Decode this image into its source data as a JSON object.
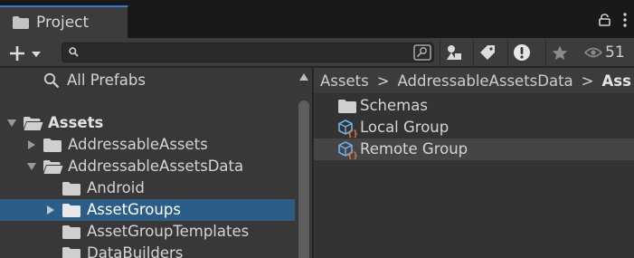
{
  "tab": {
    "title": "Project",
    "icon": "folder-icon"
  },
  "tabbar_icons": [
    "lock-icon",
    "more-menu-icon"
  ],
  "toolbar": {
    "add_label": "+",
    "search": {
      "value": "",
      "placeholder": ""
    },
    "buttons": [
      "type-filter-icon",
      "label-filter-icon",
      "warning-filter-icon",
      "favorite-icon"
    ],
    "hidden_count": "51"
  },
  "tree": [
    {
      "label": "All Prefabs",
      "icon": "search-icon"
    },
    {
      "label": "Assets",
      "icon": "folder-open-icon",
      "expanded": true
    },
    {
      "label": "AddressableAssets",
      "icon": "folder-icon",
      "expanded": false
    },
    {
      "label": "AddressableAssetsData",
      "icon": "folder-open-icon",
      "expanded": true
    },
    {
      "label": "Android",
      "icon": "folder-icon"
    },
    {
      "label": "AssetGroups",
      "icon": "folder-icon",
      "selected": true
    },
    {
      "label": "AssetGroupTemplates",
      "icon": "folder-icon"
    },
    {
      "label": "DataBuilders",
      "icon": "folder-icon"
    }
  ],
  "breadcrumb": {
    "items": [
      "Assets",
      "AddressableAssetsData",
      "Ass"
    ],
    "separator": ">"
  },
  "files": [
    {
      "label": "Schemas",
      "icon": "folder-icon"
    },
    {
      "label": "Local Group",
      "icon": "addressable-group-icon"
    },
    {
      "label": "Remote Group",
      "icon": "addressable-group-icon",
      "highlighted": true
    }
  ],
  "colors": {
    "selection": "#2c5d87",
    "tab_accent": "#3a78d0",
    "group_icon_blue": "#6fb3e8",
    "group_icon_orange": "#e8763a"
  }
}
